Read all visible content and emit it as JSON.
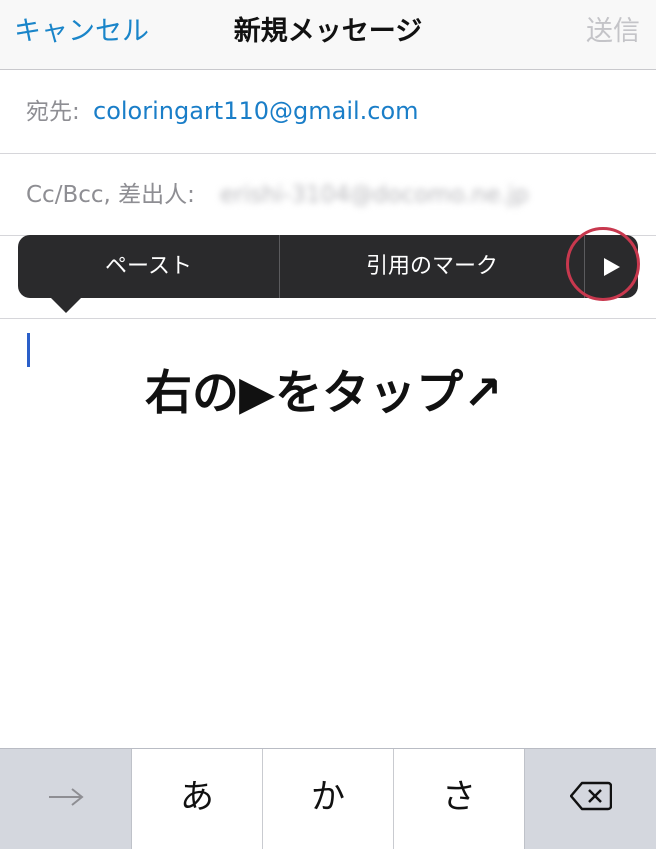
{
  "navbar": {
    "cancel_label": "キャンセル",
    "title": "新規メッセージ",
    "send_label": "送信"
  },
  "fields": {
    "to_label": "宛先:",
    "to_value": "coloringart110@gmail.com",
    "cc_label": "Cc/Bcc, 差出人:",
    "from_value": "erishi-3104@docomo.ne.jp"
  },
  "edit_menu": {
    "paste_label": "ペースト",
    "quote_label": "引用のマーク",
    "more_icon": "play-triangle-icon"
  },
  "body": {
    "annotation": "右の▶をタップ↗"
  },
  "keyboard": {
    "key_next_icon": "arrow-right-icon",
    "key_a": "あ",
    "key_ka": "か",
    "key_sa": "さ",
    "key_delete_icon": "backspace-icon"
  },
  "colors": {
    "accent": "#1a85c9",
    "highlight": "#c8384e",
    "menu_bg": "#2a2a2c"
  }
}
